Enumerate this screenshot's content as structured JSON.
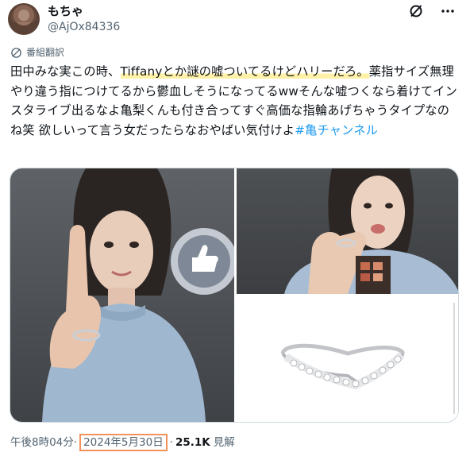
{
  "post": {
    "display_name": "もちゃ",
    "handle": "@AjOx84336",
    "translate_label": "番組翻訳",
    "text_before": "田中みな実この時、",
    "text_highlight": "Tiffanyとか謎の嘘ついてるけどハリーだろ。",
    "text_after": "薬指サイズ無理やり違う指につけてるから鬱血しそうになってるwwそんな嘘つくなら着けてインスタライブ出るなよ亀梨くんも付き合ってすぐ高価な指輪あげちゃうタイプなのね笑 欲しいって言う女だったらなおやばい気付けよ",
    "hashtag": "#亀チャンネル",
    "time": "午後8時04分",
    "separator": "·",
    "date": "2024年5月30日",
    "views_count": "25.1K",
    "views_label": "見解"
  },
  "icons": {
    "header_left": "grok-slash-icon",
    "header_right": "more-icon",
    "translate": "translate-globe-icon"
  },
  "colors": {
    "highlight": "#fff2a8",
    "hashtag": "#1d9bf0",
    "date_box": "#f2925a",
    "secondary_text": "#536471"
  }
}
